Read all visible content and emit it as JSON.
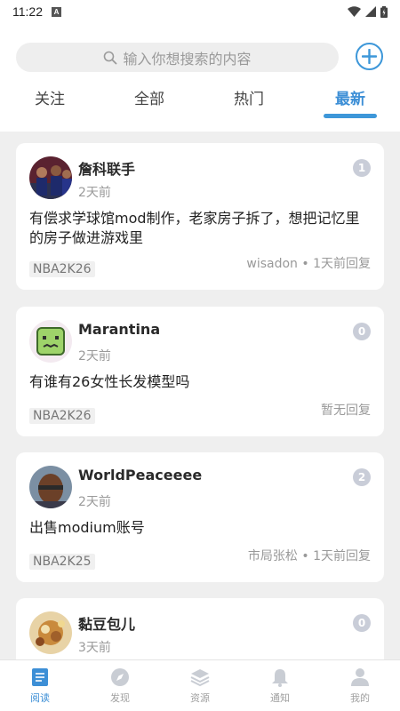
{
  "status_bar": {
    "time": "11:22",
    "indicator": "A"
  },
  "search": {
    "placeholder": "输入你想搜索的内容"
  },
  "tabs": [
    {
      "label": "关注"
    },
    {
      "label": "全部"
    },
    {
      "label": "热门"
    },
    {
      "label": "最新",
      "active": true
    }
  ],
  "posts": [
    {
      "author": "詹科联手",
      "time": "2天前",
      "count": "1",
      "title": "有偿求学球馆mod制作，老家房子拆了，想把记忆里的房子做进游戏里",
      "tag": "NBA2K26",
      "reply": "wisadon • 1天前回复"
    },
    {
      "author": "Marantina",
      "time": "2天前",
      "count": "0",
      "title": "有谁有26女性长发模型吗",
      "tag": "NBA2K26",
      "reply": "暂无回复"
    },
    {
      "author": "WorldPeaceeee",
      "time": "2天前",
      "count": "2",
      "title": "出售modium账号",
      "tag": "NBA2K25",
      "reply": "市局张松 • 1天前回复"
    },
    {
      "author": "黏豆包儿",
      "time": "3天前",
      "count": "0",
      "title": "",
      "tag": "",
      "reply": ""
    }
  ],
  "bottom_nav": [
    {
      "label": "阅读",
      "icon": "book-icon",
      "active": true
    },
    {
      "label": "发现",
      "icon": "compass-icon"
    },
    {
      "label": "资源",
      "icon": "layers-icon"
    },
    {
      "label": "通知",
      "icon": "bell-icon"
    },
    {
      "label": "我的",
      "icon": "person-icon"
    }
  ],
  "colors": {
    "accent": "#3d97d9",
    "badge": "#c9cdd8",
    "background": "#efefef"
  }
}
